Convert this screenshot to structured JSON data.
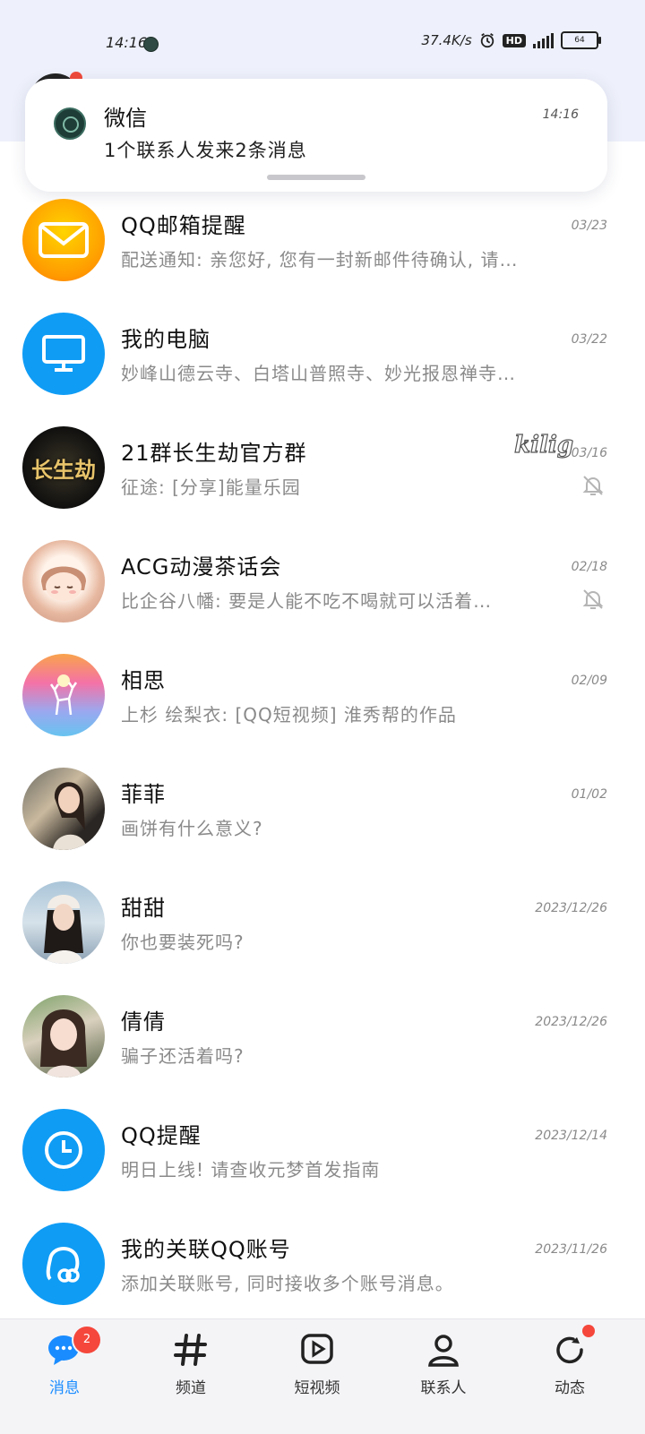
{
  "status_bar": {
    "time": "14:16",
    "net_speed": "37.4K/s",
    "hd": "HD",
    "battery": "64"
  },
  "notification": {
    "app": "微信",
    "time": "14:16",
    "text": "1个联系人发来2条消息"
  },
  "chats": [
    {
      "name": "QQ邮箱提醒",
      "preview": "配送通知: 亲您好, 您有一封新邮件待确认, 请…",
      "date": "03/23",
      "muted": false
    },
    {
      "name": "我的电脑",
      "preview": "妙峰山德云寺、白塔山普照寺、妙光报恩禅寺…",
      "date": "03/22",
      "muted": false
    },
    {
      "name": "21群长生劫官方群",
      "preview": "征途: [分享]能量乐园",
      "date": "03/16",
      "muted": true,
      "tag": "kilig"
    },
    {
      "name": "ACG动漫茶话会",
      "preview": "比企谷八幡: 要是人能不吃不喝就可以活着…",
      "date": "02/18",
      "muted": true
    },
    {
      "name": "相思",
      "preview": "上杉 绘梨衣: [QQ短视频] 淮秀帮的作品",
      "date": "02/09",
      "muted": false
    },
    {
      "name": "菲菲",
      "preview": "画饼有什么意义?",
      "date": "01/02",
      "muted": false
    },
    {
      "name": "甜甜",
      "preview": "你也要装死吗?",
      "date": "2023/12/26",
      "muted": false
    },
    {
      "name": "倩倩",
      "preview": "骗子还活着吗?",
      "date": "2023/12/26",
      "muted": false
    },
    {
      "name": "QQ提醒",
      "preview": "明日上线! 请查收元梦首发指南",
      "date": "2023/12/14",
      "muted": false
    },
    {
      "name": "我的关联QQ账号",
      "preview": "添加关联账号, 同时接收多个账号消息。",
      "date": "2023/11/26",
      "muted": false
    }
  ],
  "avatar_art": {
    "group_logo_text": "长生劫"
  },
  "tabs": [
    {
      "label": "消息",
      "badge": "2",
      "icon": "chat-bubble-icon",
      "active": true
    },
    {
      "label": "频道",
      "icon": "hash-icon"
    },
    {
      "label": "短视频",
      "icon": "video-play-icon"
    },
    {
      "label": "联系人",
      "icon": "person-icon"
    },
    {
      "label": "动态",
      "icon": "refresh-star-icon",
      "dot": true
    }
  ],
  "colors": {
    "accent": "#1a8cff",
    "badge": "#f5473b",
    "header_bg": "#eef1fb"
  }
}
